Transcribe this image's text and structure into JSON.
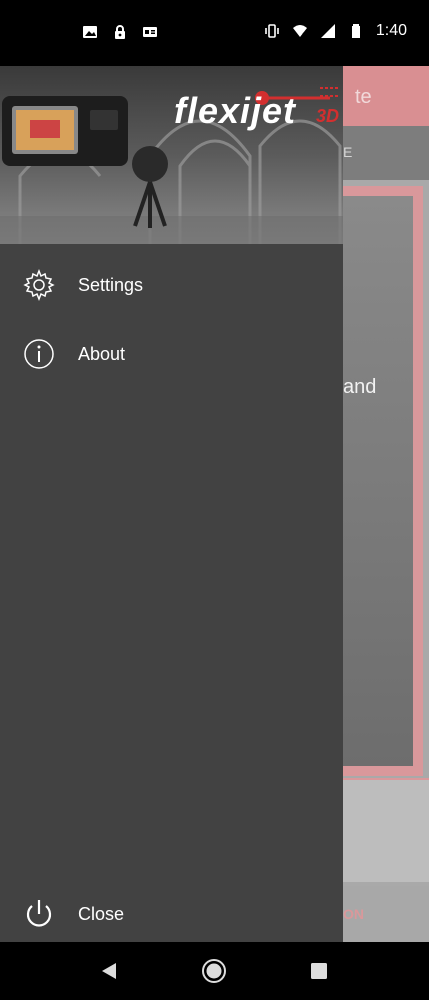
{
  "status_bar": {
    "time": "1:40",
    "left_icons": [
      "image-icon",
      "lock-icon",
      "gallery-icon"
    ],
    "right_icons": [
      "vibrate-icon",
      "wifi-icon",
      "signal-icon",
      "battery-icon"
    ]
  },
  "background_app": {
    "title_fragment": "te",
    "tab_fragment": "E",
    "body_fragment": "and",
    "button_fragment": "ON"
  },
  "drawer": {
    "header": {
      "logo_text": "flexijet",
      "logo_suffix": "3D"
    },
    "items": [
      {
        "label": "Settings",
        "icon": "gear-icon"
      },
      {
        "label": "About",
        "icon": "info-icon"
      }
    ],
    "footer_item": {
      "label": "Close",
      "icon": "power-icon"
    }
  },
  "nav_bar": {
    "buttons": [
      "back-icon",
      "home-icon",
      "recents-icon"
    ]
  },
  "colors": {
    "drawer_bg": "#424242",
    "accent": "#d32f2f",
    "scrim_app_bar": "#d98f92"
  }
}
